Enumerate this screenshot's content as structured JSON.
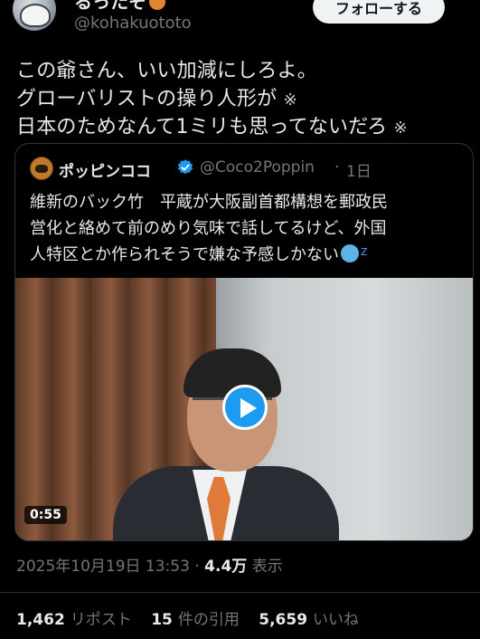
{
  "header": {
    "display_name": "るったそ",
    "handle": "@kohakuototo",
    "follow_label": "フォローする"
  },
  "tweet": {
    "lines": [
      "この爺さん、いい加減にしろよ。",
      "グローバリストの操り人形が",
      "日本のためなんて1ミリも思ってないだろ"
    ],
    "mark": "※"
  },
  "quote": {
    "name": "ポッピンココ",
    "handle": "@Coco2Poppin",
    "separator": "·",
    "time": "1日",
    "lines": [
      "維新のバック竹　平蔵が大阪副首都構想を郵政民",
      "営化と絡めて前のめり気味で話してるけど、外国",
      "人特区とか作られそうで嫌な予感しかない"
    ],
    "video_duration": "0:55"
  },
  "meta": {
    "datetime": "2025年10月19日 13:53",
    "separator": "·",
    "views_count": "4.4万",
    "views_label": "表示"
  },
  "stats": {
    "reposts_count": "1,462",
    "reposts_label": "リポスト",
    "quotes_count": "15",
    "quotes_label": "件の引用",
    "likes_count": "5,659",
    "likes_label": "いいね"
  },
  "colors": {
    "background": "#000000",
    "text": "#e7e9ea",
    "muted": "#71767b",
    "accent": "#1d9bf0",
    "border": "#2f3336"
  }
}
